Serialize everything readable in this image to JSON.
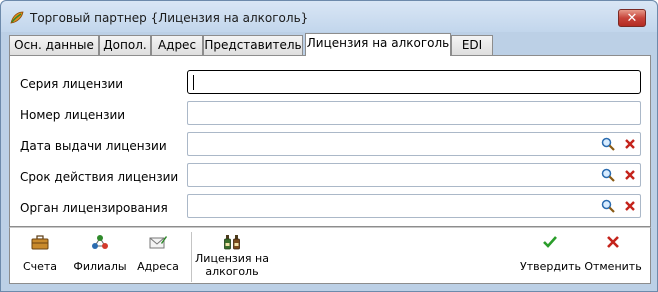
{
  "window": {
    "title": "Торговый партнер {Лицензия на алкоголь}",
    "close_label": "✕"
  },
  "tabs": [
    {
      "label": "Осн. данные",
      "active": false
    },
    {
      "label": "Допол.",
      "active": false
    },
    {
      "label": "Адрес",
      "active": false
    },
    {
      "label": "Представитель",
      "active": false
    },
    {
      "label": "Лицензия на алкоголь",
      "active": true
    },
    {
      "label": "EDI",
      "active": false
    }
  ],
  "form": {
    "fields": [
      {
        "label": "Серия лицензии",
        "value": "",
        "focused": true,
        "actions": []
      },
      {
        "label": "Номер лицензии",
        "value": "",
        "focused": false,
        "actions": []
      },
      {
        "label": "Дата выдачи лицензии",
        "value": "",
        "focused": false,
        "actions": [
          "search-icon",
          "clear-icon"
        ]
      },
      {
        "label": "Срок действия лицензии",
        "value": "",
        "focused": false,
        "actions": [
          "search-icon",
          "clear-icon"
        ]
      },
      {
        "label": "Орган лицензирования",
        "value": "",
        "focused": false,
        "actions": [
          "search-icon",
          "clear-icon"
        ]
      }
    ]
  },
  "toolbar": {
    "accounts_label": "Счета",
    "branches_label": "Филиалы",
    "addresses_label": "Адреса",
    "license_label_line1": "Лицензия на",
    "license_label_line2": "алкоголь",
    "approve_label": "Утвердить",
    "cancel_label": "Отменить"
  },
  "colors": {
    "window_frame": "#bcd0e6",
    "close_button": "#c7443a",
    "approve_check": "#2a9d2a",
    "cancel_x": "#c4231b",
    "clear_x": "#c4231b"
  }
}
